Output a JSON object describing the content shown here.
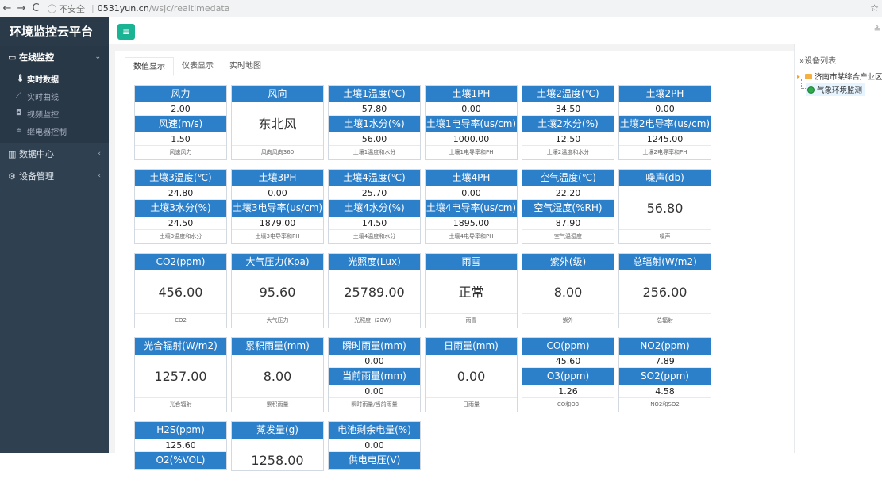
{
  "browser": {
    "back": "←",
    "forward": "→",
    "reload": "C",
    "info": "ⓘ",
    "insecure": "不安全",
    "host": "0531yun.cn",
    "path": "/wsjc/realtimedata",
    "star": "☆"
  },
  "app": {
    "brand": "环境监控云平台",
    "top_right": "≗"
  },
  "sidebar": {
    "groups": [
      {
        "icon": "monitor-icon",
        "label": "在线监控",
        "arrow": "⌄"
      },
      {
        "icon": "bar-chart-icon",
        "label": "数据中心",
        "arrow": "‹"
      },
      {
        "icon": "gears-icon",
        "label": "设备管理",
        "arrow": "‹"
      }
    ],
    "items": [
      {
        "icon": "thermometer-icon",
        "label": "实时数据"
      },
      {
        "icon": "line-chart-icon",
        "label": "实时曲线"
      },
      {
        "icon": "camera-icon",
        "label": "视频监控"
      },
      {
        "icon": "sliders-icon",
        "label": "继电器控制"
      }
    ]
  },
  "tabs": [
    "数值显示",
    "仪表显示",
    "实时地图"
  ],
  "cards": {
    "r1c1": {
      "h1": "风力",
      "v1": "2.00",
      "h2": "风速(m/s)",
      "v2": "1.50",
      "foot": "风速风力"
    },
    "r1c2": {
      "h1": "风向",
      "big": "东北风",
      "foot": "风向风向360"
    },
    "r1c3": {
      "h1": "土壤1温度(℃)",
      "v1": "57.80",
      "h2": "土壤1水分(%)",
      "v2": "56.00",
      "foot": "土壤1温度和水分"
    },
    "r1c4": {
      "h1": "土壤1PH",
      "v1": "0.00",
      "h2": "土壤1电导率(us/cm)",
      "v2": "1000.00",
      "foot": "土壤1电导率和PH"
    },
    "r1c5": {
      "h1": "土壤2温度(℃)",
      "v1": "34.50",
      "h2": "土壤2水分(%)",
      "v2": "12.50",
      "foot": "土壤2温度和水分"
    },
    "r1c6": {
      "h1": "土壤2PH",
      "v1": "0.00",
      "h2": "土壤2电导率(us/cm)",
      "v2": "1245.00",
      "foot": "土壤2电导率和PH"
    },
    "r2c1": {
      "h1": "土壤3温度(℃)",
      "v1": "24.80",
      "h2": "土壤3水分(%)",
      "v2": "24.50",
      "foot": "土壤3温度和水分"
    },
    "r2c2": {
      "h1": "土壤3PH",
      "v1": "0.00",
      "h2": "土壤3电导率(us/cm)",
      "v2": "1879.00",
      "foot": "土壤3电导率和PH"
    },
    "r2c3": {
      "h1": "土壤4温度(℃)",
      "v1": "25.70",
      "h2": "土壤4水分(%)",
      "v2": "14.50",
      "foot": "土壤4温度和水分"
    },
    "r2c4": {
      "h1": "土壤4PH",
      "v1": "0.00",
      "h2": "土壤4电导率(us/cm)",
      "v2": "1895.00",
      "foot": "土壤4电导率和PH"
    },
    "r2c5": {
      "h1": "空气温度(℃)",
      "v1": "22.20",
      "h2": "空气湿度(%RH)",
      "v2": "87.90",
      "foot": "空气温湿度"
    },
    "r2c6": {
      "h1": "噪声(db)",
      "big": "56.80",
      "foot": "噪声"
    },
    "r3c1": {
      "h1": "CO2(ppm)",
      "big": "456.00",
      "foot": "CO2"
    },
    "r3c2": {
      "h1": "大气压力(Kpa)",
      "big": "95.60",
      "foot": "大气压力"
    },
    "r3c3": {
      "h1": "光照度(Lux)",
      "big": "25789.00",
      "foot": "光照度（20W）"
    },
    "r3c4": {
      "h1": "雨雪",
      "big": "正常",
      "foot": "雨雪"
    },
    "r3c5": {
      "h1": "紫外(级)",
      "big": "8.00",
      "foot": "紫外"
    },
    "r3c6": {
      "h1": "总辐射(W/m2)",
      "big": "256.00",
      "foot": "总辐射"
    },
    "r4c1": {
      "h1": "光合辐射(W/m2)",
      "big": "1257.00",
      "foot": "光合辐射"
    },
    "r4c2": {
      "h1": "累积雨量(mm)",
      "big": "8.00",
      "foot": "累积雨量"
    },
    "r4c3": {
      "h1": "瞬时雨量(mm)",
      "v1": "0.00",
      "h2": "当前雨量(mm)",
      "v2": "0.00",
      "foot": "瞬时雨量/当前雨量"
    },
    "r4c4": {
      "h1": "日雨量(mm)",
      "big": "0.00",
      "foot": "日雨量"
    },
    "r4c5": {
      "h1": "CO(ppm)",
      "v1": "45.60",
      "h2": "O3(ppm)",
      "v2": "1.26",
      "foot": "CO和O3"
    },
    "r4c6": {
      "h1": "NO2(ppm)",
      "v1": "7.89",
      "h2": "SO2(ppm)",
      "v2": "4.58",
      "foot": "NO2和SO2"
    },
    "r5c1": {
      "h1": "H2S(ppm)",
      "v1": "125.60",
      "h2": "O2(%VOL)"
    },
    "r5c2": {
      "h1": "蒸发量(g)",
      "big": "1258.00"
    },
    "r5c3": {
      "h1": "电池剩余电量(%)",
      "v1": "0.00",
      "h2": "供电电压(V)"
    }
  },
  "device_panel": {
    "title": "»设备列表",
    "tree_toggle": "▸",
    "root": "济南市某综合产业区",
    "child": "气象环境监测"
  }
}
